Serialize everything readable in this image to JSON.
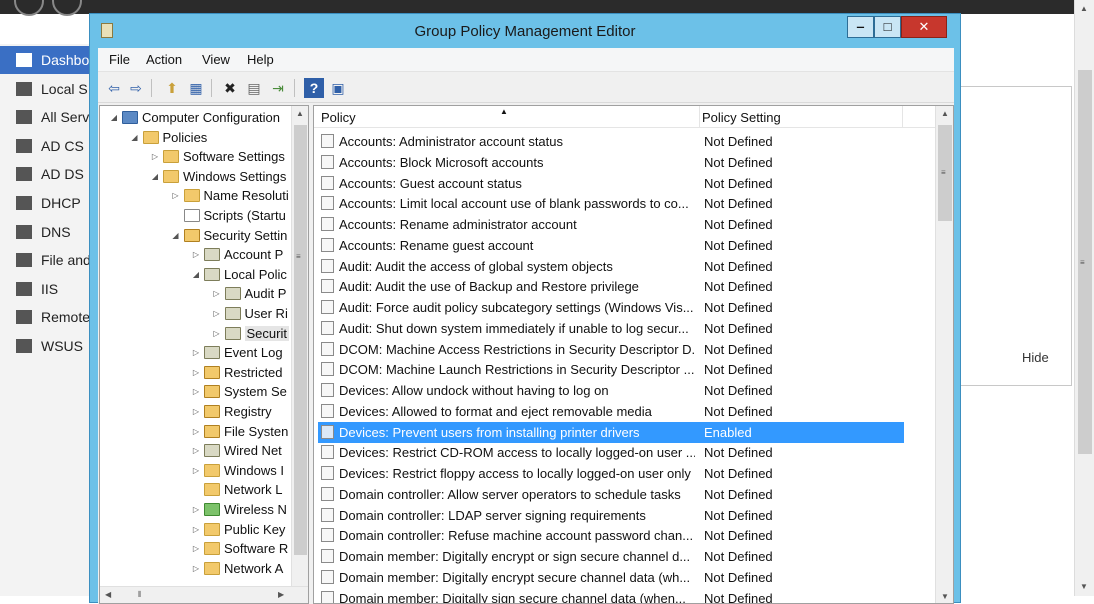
{
  "background_app": {
    "nav_items": [
      {
        "label": "Dashbo",
        "icon": "grid-icon",
        "active": true
      },
      {
        "label": "Local S",
        "icon": "server-icon"
      },
      {
        "label": "All Serv",
        "icon": "servers-icon"
      },
      {
        "label": "AD CS",
        "icon": "certificate-icon"
      },
      {
        "label": "AD DS",
        "icon": "directory-icon"
      },
      {
        "label": "DHCP",
        "icon": "dhcp-icon"
      },
      {
        "label": "DNS",
        "icon": "dns-icon"
      },
      {
        "label": "File and",
        "icon": "file-server-icon"
      },
      {
        "label": "IIS",
        "icon": "iis-icon"
      },
      {
        "label": "Remote",
        "icon": "remote-icon"
      },
      {
        "label": "WSUS",
        "icon": "wsus-icon"
      }
    ],
    "hide_label": "Hide",
    "accent_color": "#3a6fc4"
  },
  "window": {
    "title": "Group Policy Management Editor",
    "minimize": "‒",
    "maximize": "□",
    "close": "✕"
  },
  "menu": [
    "File",
    "Action",
    "View",
    "Help"
  ],
  "toolbar": {
    "icons": [
      "back-icon",
      "forward-icon",
      "up-folder-icon",
      "show-hide-tree-icon",
      "delete-icon",
      "properties-icon",
      "export-list-icon",
      "help-icon",
      "view-icon"
    ],
    "glyphs": [
      "⇦",
      "⇨",
      "⬆",
      "▦",
      "✖",
      "▤",
      "⇥",
      "?",
      "▣"
    ]
  },
  "tree": [
    {
      "label": "Computer Configuration",
      "exp": "◢",
      "icon": "comp",
      "level": 0
    },
    {
      "label": "Policies",
      "exp": "◢",
      "icon": "folder",
      "level": 1
    },
    {
      "label": "Software Settings",
      "exp": "▷",
      "icon": "folder",
      "level": 2
    },
    {
      "label": "Windows Settings",
      "exp": "◢",
      "icon": "folder",
      "level": 2
    },
    {
      "label": "Name Resoluti",
      "exp": "▷",
      "icon": "folder",
      "level": 3
    },
    {
      "label": "Scripts (Startu",
      "exp": "",
      "icon": "doc",
      "level": 3
    },
    {
      "label": "Security Settin",
      "exp": "◢",
      "icon": "lock",
      "level": 3
    },
    {
      "label": "Account P",
      "exp": "▷",
      "icon": "sec",
      "level": 4
    },
    {
      "label": "Local Polic",
      "exp": "◢",
      "icon": "sec",
      "level": 4
    },
    {
      "label": "Audit P",
      "exp": "▷",
      "icon": "sec",
      "level": 5
    },
    {
      "label": "User Ri",
      "exp": "▷",
      "icon": "sec",
      "level": 5
    },
    {
      "label": "Securit",
      "exp": "▷",
      "icon": "sec",
      "level": 5,
      "selected": true
    },
    {
      "label": "Event Log",
      "exp": "▷",
      "icon": "sec",
      "level": 4
    },
    {
      "label": "Restricted",
      "exp": "▷",
      "icon": "lock",
      "level": 4
    },
    {
      "label": "System Se",
      "exp": "▷",
      "icon": "lock",
      "level": 4
    },
    {
      "label": "Registry",
      "exp": "▷",
      "icon": "lock",
      "level": 4
    },
    {
      "label": "File Systen",
      "exp": "▷",
      "icon": "lock",
      "level": 4
    },
    {
      "label": "Wired Net",
      "exp": "▷",
      "icon": "sec",
      "level": 4
    },
    {
      "label": "Windows I",
      "exp": "▷",
      "icon": "folder",
      "level": 4
    },
    {
      "label": "Network L",
      "exp": "",
      "icon": "folder",
      "level": 4
    },
    {
      "label": "Wireless N",
      "exp": "▷",
      "icon": "wifi",
      "level": 4
    },
    {
      "label": "Public Key",
      "exp": "▷",
      "icon": "folder",
      "level": 4
    },
    {
      "label": "Software R",
      "exp": "▷",
      "icon": "folder",
      "level": 4
    },
    {
      "label": "Network A",
      "exp": "▷",
      "icon": "folder",
      "level": 4
    }
  ],
  "list": {
    "columns": [
      "Policy",
      "Policy Setting"
    ],
    "rows": [
      {
        "policy": "Accounts: Administrator account status",
        "setting": "Not Defined"
      },
      {
        "policy": "Accounts: Block Microsoft accounts",
        "setting": "Not Defined"
      },
      {
        "policy": "Accounts: Guest account status",
        "setting": "Not Defined"
      },
      {
        "policy": "Accounts: Limit local account use of blank passwords to co...",
        "setting": "Not Defined"
      },
      {
        "policy": "Accounts: Rename administrator account",
        "setting": "Not Defined"
      },
      {
        "policy": "Accounts: Rename guest account",
        "setting": "Not Defined"
      },
      {
        "policy": "Audit: Audit the access of global system objects",
        "setting": "Not Defined"
      },
      {
        "policy": "Audit: Audit the use of Backup and Restore privilege",
        "setting": "Not Defined"
      },
      {
        "policy": "Audit: Force audit policy subcategory settings (Windows Vis...",
        "setting": "Not Defined"
      },
      {
        "policy": "Audit: Shut down system immediately if unable to log secur...",
        "setting": "Not Defined"
      },
      {
        "policy": "DCOM: Machine Access Restrictions in Security Descriptor D...",
        "setting": "Not Defined"
      },
      {
        "policy": "DCOM: Machine Launch Restrictions in Security Descriptor ...",
        "setting": "Not Defined"
      },
      {
        "policy": "Devices: Allow undock without having to log on",
        "setting": "Not Defined"
      },
      {
        "policy": "Devices: Allowed to format and eject removable media",
        "setting": "Not Defined"
      },
      {
        "policy": "Devices: Prevent users from installing printer drivers",
        "setting": "Enabled",
        "selected": true
      },
      {
        "policy": "Devices: Restrict CD-ROM access to locally logged-on user ...",
        "setting": "Not Defined"
      },
      {
        "policy": "Devices: Restrict floppy access to locally logged-on user only",
        "setting": "Not Defined"
      },
      {
        "policy": "Domain controller: Allow server operators to schedule tasks",
        "setting": "Not Defined"
      },
      {
        "policy": "Domain controller: LDAP server signing requirements",
        "setting": "Not Defined"
      },
      {
        "policy": "Domain controller: Refuse machine account password chan...",
        "setting": "Not Defined"
      },
      {
        "policy": "Domain member: Digitally encrypt or sign secure channel d...",
        "setting": "Not Defined"
      },
      {
        "policy": "Domain member: Digitally encrypt secure channel data (wh...",
        "setting": "Not Defined"
      },
      {
        "policy": "Domain member: Digitally sign secure channel data (when...",
        "setting": "Not Defined"
      }
    ],
    "selection_color": "#3399ff"
  }
}
